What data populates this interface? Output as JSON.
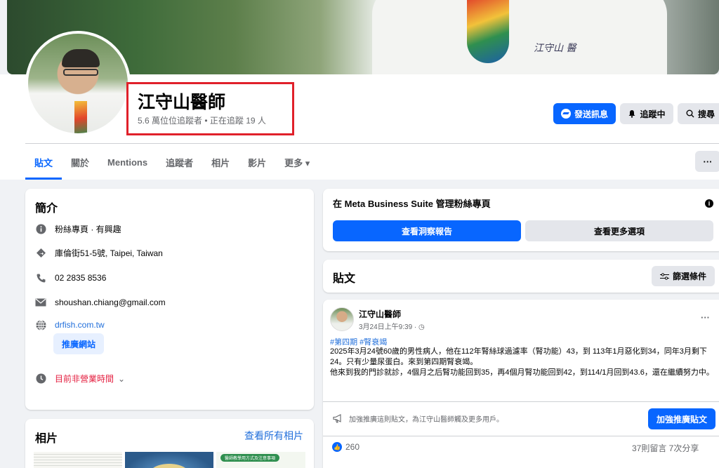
{
  "cover": {
    "signature": "江守山 醫"
  },
  "page": {
    "name": "江守山醫師",
    "subtitle": "5.6 萬位位追蹤者 • 正在追蹤 19 人"
  },
  "actions": {
    "message": "發送訊息",
    "following": "追蹤中",
    "search": "搜尋"
  },
  "tabs": [
    {
      "label": "貼文"
    },
    {
      "label": "關於"
    },
    {
      "label": "Mentions"
    },
    {
      "label": "追蹤者"
    },
    {
      "label": "相片"
    },
    {
      "label": "影片"
    },
    {
      "label": "更多 ▾"
    }
  ],
  "more_dots": "···",
  "intro": {
    "title": "簡介",
    "category": "粉絲專頁 · 有興趣",
    "address": "庫倫街51-5號, Taipei, Taiwan",
    "phone": "02 2835 8536",
    "email": "shoushan.chiang@gmail.com",
    "website": "drfish.com.tw",
    "promote_site": "推廣網站",
    "hours": "目前非營業時間",
    "hours_chevron": "⌄"
  },
  "photos": {
    "title": "相片",
    "see_all": "查看所有相片",
    "thumb3_caption": "醫師教學用方式及注意事項"
  },
  "business": {
    "title": "在 Meta Business Suite 管理粉絲專頁",
    "insights": "查看洞察報告",
    "more_options": "查看更多選項",
    "info": "i"
  },
  "posts_header": {
    "title": "貼文",
    "filter": "篩選條件"
  },
  "post": {
    "author": "江守山醫師",
    "time": "3月24日上午9:39 · ◷",
    "dots": "···",
    "hashtags": "#第四期 #腎衰竭",
    "text": "2025年3月24號60歲的男性病人，他在112年腎絲球過濾率（腎功能）43，到 113年1月惡化到34，同年3月剩下24。只有少量尿蛋白。來到第四期腎衰竭。\n他來到我的門診就診，4個月之后腎功能回到35，再4個月腎功能回到42，到114/1月回到43.6，還在繼續努力中。",
    "boost_text": "加強推廣這則貼文，為江守山醫師觸及更多用戶。",
    "boost_button": "加強推廣貼文",
    "likes": "260",
    "stats": "37則留言 7次分享"
  }
}
